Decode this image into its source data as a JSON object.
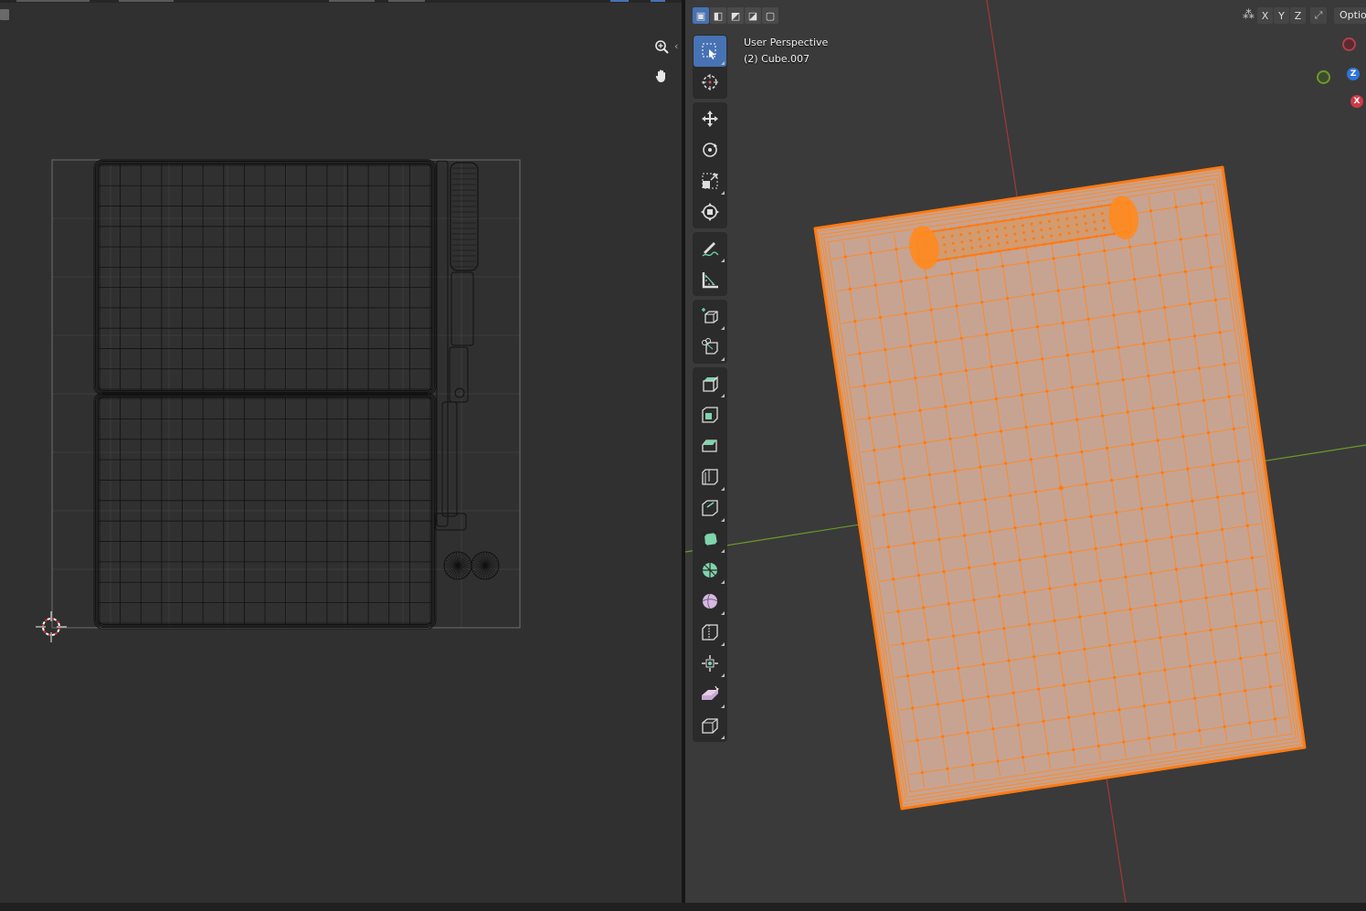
{
  "uv_editor": {
    "icons": [
      "zoom-icon",
      "pan-hand-icon"
    ]
  },
  "viewport": {
    "view_name": "User Perspective",
    "object_label": "(2) Cube.007",
    "header": {
      "select_modes": [
        "select-new",
        "select-extend",
        "select-subtract",
        "select-invert",
        "select-intersect"
      ],
      "axis_locks": [
        "X",
        "Y",
        "Z"
      ],
      "options_label": "Optio"
    },
    "gizmo": {
      "z_label": "Z",
      "x_label": "X"
    },
    "toolbar": [
      "select-box-icon",
      "cursor-icon",
      "move-icon",
      "rotate-icon",
      "scale-icon",
      "transform-icon",
      "annotate-icon",
      "measure-icon",
      "add-cube-icon",
      "knife-cube-icon",
      "extrude-icon",
      "inset-icon",
      "bevel-icon",
      "loop-cut-icon",
      "offset-edge-icon",
      "poly-build-icon",
      "spin-icon",
      "smooth-icon",
      "edge-slide-icon",
      "shrink-fatten-icon",
      "shear-icon",
      "rip-region-icon"
    ],
    "colors": {
      "selection": "#ff8a1f",
      "face_fill": "#c9a694",
      "axis_x": "#b23a3a",
      "axis_y": "#6a9a2a",
      "accent": "#4772b3"
    }
  }
}
